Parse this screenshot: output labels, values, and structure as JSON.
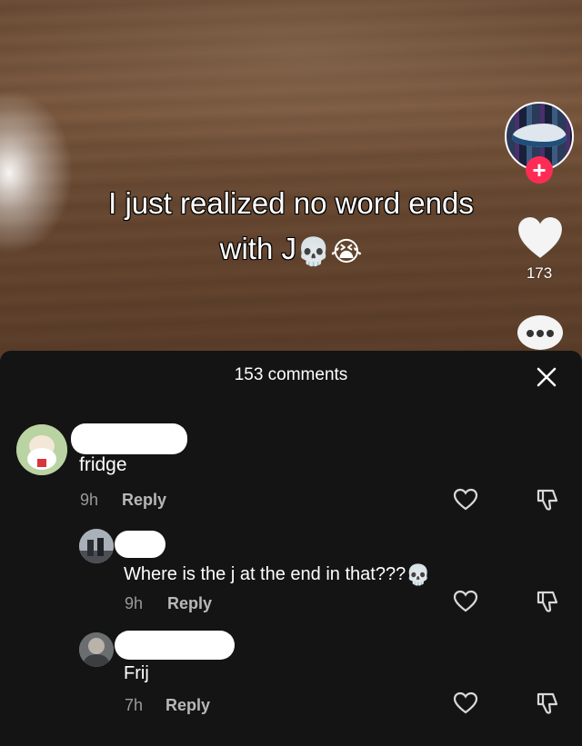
{
  "video": {
    "caption_line1": "I just realized no word ends",
    "caption_line2": "with J",
    "caption_emojis": [
      "💀",
      "😭"
    ],
    "like_count": "173",
    "icons": [
      "creator-avatar",
      "follow-plus-icon",
      "heart-icon",
      "comment-bubble-icon"
    ],
    "follow_symbol": "+"
  },
  "comments_sheet": {
    "title": "153 comments",
    "close_symbol": "✕",
    "reply_label": "Reply",
    "comments": [
      {
        "text": "fridge",
        "time": "9h",
        "emoji": ""
      },
      {
        "text": "Where is the j at the end in that???",
        "time": "9h",
        "emoji": "💀"
      },
      {
        "text": "Frij",
        "time": "7h",
        "emoji": ""
      }
    ]
  },
  "colors": {
    "sheet_bg": "#141414",
    "accent_pink": "#fe2c55",
    "meta_gray": "#9a9a9a"
  }
}
